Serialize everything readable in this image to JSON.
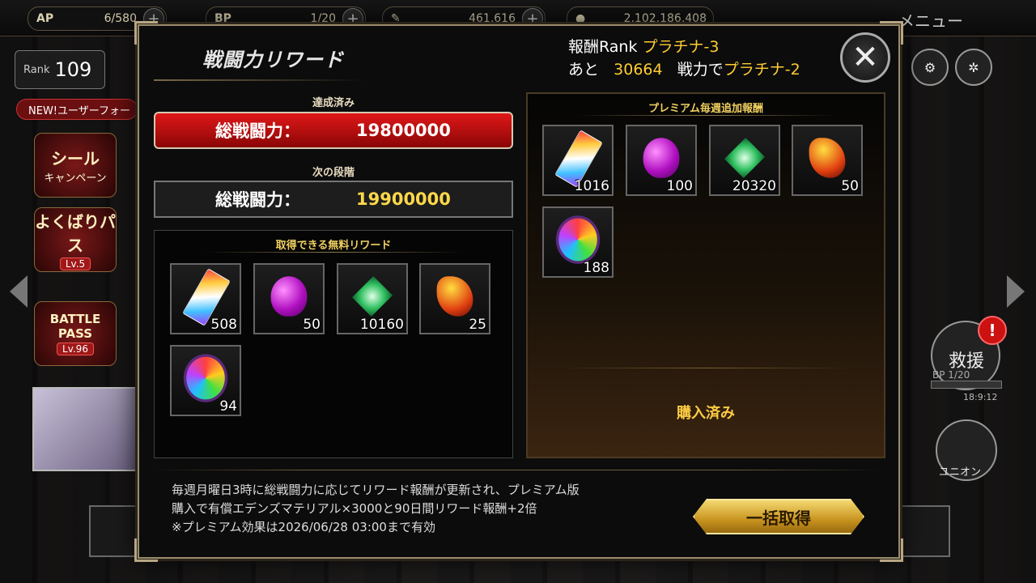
{
  "hud": {
    "ap_label": "AP",
    "ap_value": "6/580",
    "bp_label": "BP",
    "bp_value": "1/20",
    "coin_value": "461,616",
    "gem_value": "2,102,186,408",
    "menu_label": "メニュー"
  },
  "sidebar": {
    "rank_label": "Rank",
    "rank_value": "109",
    "new_button": "NEW!ユーザーフォー",
    "seal_title": "シール",
    "seal_sub": "キャンペーン",
    "yokubari_title": "よくばりパス",
    "yokubari_lv": "Lv.5",
    "battlepass_title": "BATTLE PASS",
    "battlepass_lv": "Lv.96"
  },
  "right_hud": {
    "rescue_label": "救援",
    "bp_label": "BP",
    "bp_value": "1/20",
    "time": "18:9:12",
    "alert": "!",
    "union_label": "ユニオン"
  },
  "modal": {
    "title": "戦闘力リワード",
    "rank_prefix": "報酬Rank",
    "rank_value": "プラチナ-3",
    "next_prefix": "あと",
    "next_amount": "30664",
    "next_mid": "戦力で",
    "next_rank": "プラチナ-2",
    "close_symbol": "✕",
    "achieved_label": "達成済み",
    "achieved_power_label": "総戦闘力：",
    "achieved_power_value": "19800000",
    "next_stage_label": "次の段階",
    "next_power_label": "総戦闘力：",
    "next_power_value": "19900000",
    "free_title": "取得できる無料リワード",
    "free_items": [
      {
        "icon": "rainbow-crystal-icon",
        "count": "508"
      },
      {
        "icon": "purple-apple-icon",
        "count": "50"
      },
      {
        "icon": "green-gem-icon",
        "count": "10160"
      },
      {
        "icon": "fire-stone-icon",
        "count": "25"
      },
      {
        "icon": "rainbow-orb-icon",
        "count": "94"
      }
    ],
    "premium_title": "プレミアム毎週追加報酬",
    "premium_items": [
      {
        "icon": "rainbow-crystal-icon",
        "count": "1016"
      },
      {
        "icon": "purple-apple-icon",
        "count": "100"
      },
      {
        "icon": "green-gem-icon",
        "count": "20320"
      },
      {
        "icon": "fire-stone-icon",
        "count": "50"
      },
      {
        "icon": "rainbow-orb-icon",
        "count": "188"
      }
    ],
    "purchased_label": "購入済み",
    "notice_line1": "毎週月曜日3時に総戦闘力に応じてリワード報酬が更新され、プレミアム版",
    "notice_line2": "購入で有償エデンズマテリアル×3000と90日間リワード報酬+2倍",
    "notice_line3": "※プレミアム効果は2026/06/28 03:00まで有効",
    "claim_all_button": "一括取得"
  }
}
